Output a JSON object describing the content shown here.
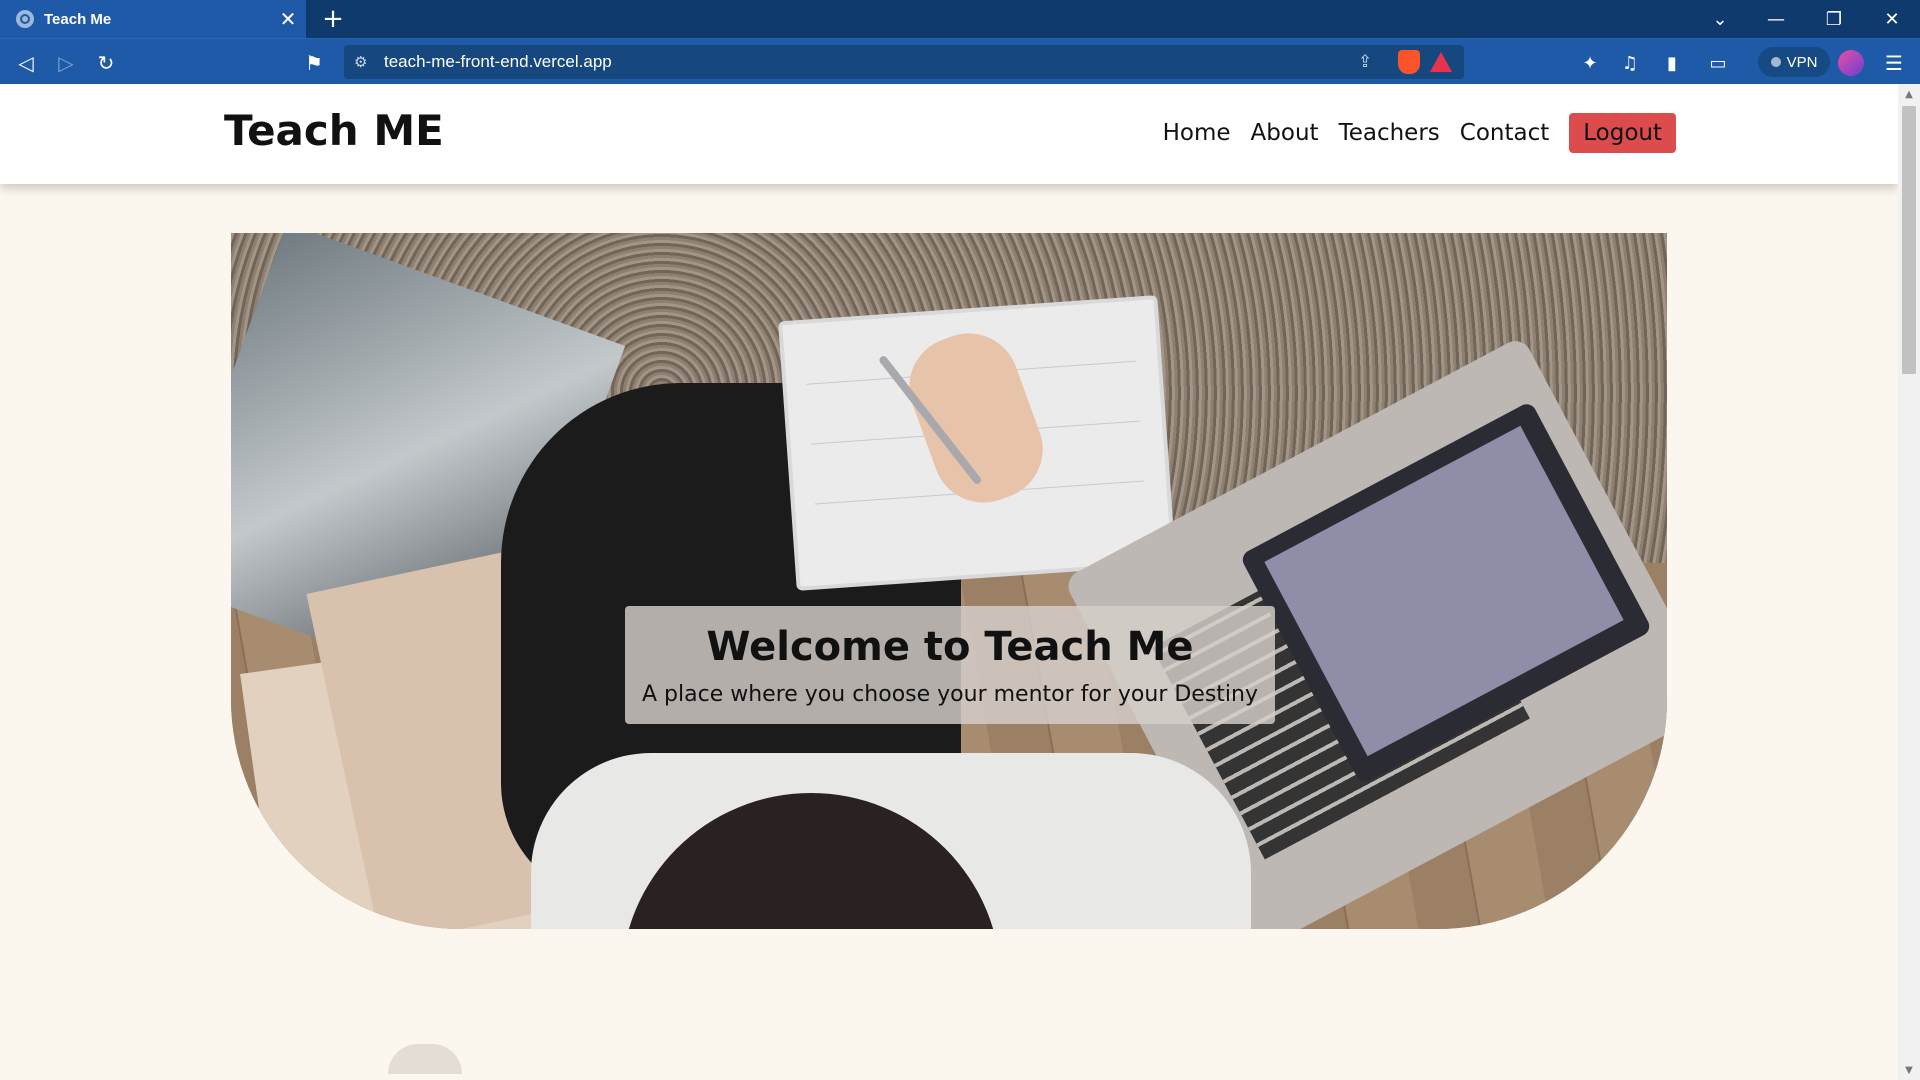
{
  "browser": {
    "tab_title": "Teach Me",
    "url": "teach-me-front-end.vercel.app",
    "vpn_label": "VPN"
  },
  "site": {
    "brand": "Teach ME",
    "nav": {
      "home": "Home",
      "about": "About",
      "teachers": "Teachers",
      "contact": "Contact",
      "logout": "Logout"
    }
  },
  "hero": {
    "title": "Welcome to Teach Me",
    "subtitle": "A place where you choose your mentor for your Destiny"
  },
  "colors": {
    "browser_frame": "#1e5aa7",
    "page_background": "#fbf7ef",
    "logout_button": "#dc4c4c"
  }
}
